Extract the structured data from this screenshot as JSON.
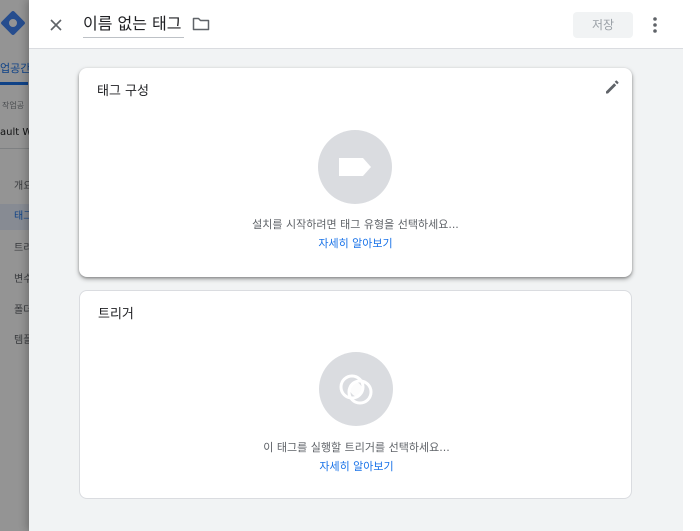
{
  "background": {
    "workspace_tab": "업공간",
    "workspace_label": "작업공",
    "workspace_name": "ault W",
    "nav_items": [
      {
        "label": "개요",
        "active": false
      },
      {
        "label": "태그",
        "active": true
      },
      {
        "label": "트리",
        "active": false
      },
      {
        "label": "변수",
        "active": false
      },
      {
        "label": "폴더",
        "active": false
      },
      {
        "label": "템플",
        "active": false
      }
    ]
  },
  "header": {
    "tag_name": "이름 없는 태그",
    "save_label": "저장",
    "close_icon": "close-icon",
    "folder_icon": "folder-icon",
    "more_icon": "more-vert-icon"
  },
  "tag_config": {
    "title": "태그 구성",
    "hint": "설치를 시작하려면 태그 유형을 선택하세요...",
    "learn_more": "자세히 알아보기",
    "icon": "tag-icon",
    "edit_icon": "pencil-icon"
  },
  "trigger": {
    "title": "트리거",
    "hint": "이 태그를 실행할 트리거를 선택하세요...",
    "learn_more": "자세히 알아보기",
    "icon": "trigger-icon"
  },
  "colors": {
    "accent": "#1a73e8",
    "icon_circle": "#dadce0",
    "panel_bg": "#f1f3f4"
  }
}
